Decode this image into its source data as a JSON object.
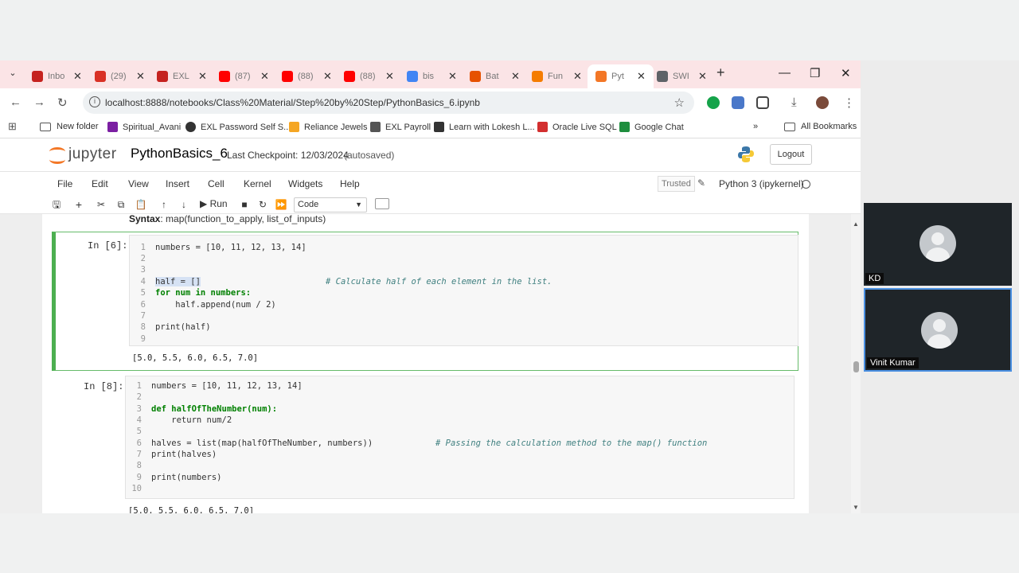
{
  "browser": {
    "tabs": [
      {
        "label": "Inbo",
        "icon_color": "#c5221f"
      },
      {
        "label": "(29)",
        "icon_color": "#d93025"
      },
      {
        "label": "EXL",
        "icon_color": "#c5221f"
      },
      {
        "label": "(87)",
        "icon_color": "#ff0000"
      },
      {
        "label": "(88)",
        "icon_color": "#ff0000"
      },
      {
        "label": "(88)",
        "icon_color": "#ff0000"
      },
      {
        "label": "bis",
        "icon_color": "#4285f4"
      },
      {
        "label": "Bat",
        "icon_color": "#e65100"
      },
      {
        "label": "Fun",
        "icon_color": "#f57c00"
      },
      {
        "label": "Pyt",
        "icon_color": "#f37726"
      },
      {
        "label": "SWI",
        "icon_color": "#5f6368"
      }
    ],
    "new_tab": "+",
    "url": "localhost:8888/notebooks/Class%20Material/Step%20by%20Step/PythonBasics_6.ipynb",
    "bookmarks": [
      {
        "label": "New folder",
        "icon": "folder-icon"
      },
      {
        "label": "Spiritual_Avani",
        "icon": "bookmark-icon"
      },
      {
        "label": "EXL Password Self S...",
        "icon": "globe-icon"
      },
      {
        "label": "Reliance Jewels",
        "icon": "bookmark-icon"
      },
      {
        "label": "EXL Payroll",
        "icon": "bookmark-icon"
      },
      {
        "label": "Learn with Lokesh L...",
        "icon": "bookmark-icon"
      },
      {
        "label": "Oracle Live SQL",
        "icon": "bookmark-icon"
      },
      {
        "label": "Google Chat",
        "icon": "bookmark-icon"
      }
    ],
    "more_bookmarks": "»",
    "all_bookmarks": "All Bookmarks"
  },
  "jupyter": {
    "logo_text": "jupyter",
    "notebook_name": "PythonBasics_6",
    "checkpoint": "Last Checkpoint: 12/03/2024",
    "autosaved": "(autosaved)",
    "logout": "Logout",
    "menu": [
      "File",
      "Edit",
      "View",
      "Insert",
      "Cell",
      "Kernel",
      "Widgets",
      "Help"
    ],
    "trusted": "Trusted",
    "kernel": "Python 3 (ipykernel)",
    "run_label": "Run",
    "cell_type": "Code"
  },
  "notebook": {
    "syntax_label": "Syntax",
    "syntax_text": ": map(function_to_apply, list_of_inputs)",
    "cells": [
      {
        "prompt": "In [6]:",
        "lines": [
          "numbers = [10, 11, 12, 13, 14]",
          "",
          "",
          "half = []",
          "for num in numbers:",
          "    half.append(num / 2)",
          "",
          "print(half)",
          ""
        ],
        "comment_4": "# Calculate half of each element in the list.",
        "output": "[5.0, 5.5, 6.0, 6.5, 7.0]"
      },
      {
        "prompt": "In [8]:",
        "lines": [
          "numbers = [10, 11, 12, 13, 14]",
          "",
          "def halfOfTheNumber(num):",
          "    return num/2",
          "",
          "halves = list(map(halfOfTheNumber, numbers))",
          "print(halves)",
          "",
          "print(numbers)",
          ""
        ],
        "comment_6": "# Passing the calculation method to the map() function",
        "output": "[5.0, 5.5, 6.0, 6.5, 7.0]"
      }
    ]
  },
  "participants": [
    {
      "name": "KD"
    },
    {
      "name": "Vinit Kumar"
    }
  ]
}
